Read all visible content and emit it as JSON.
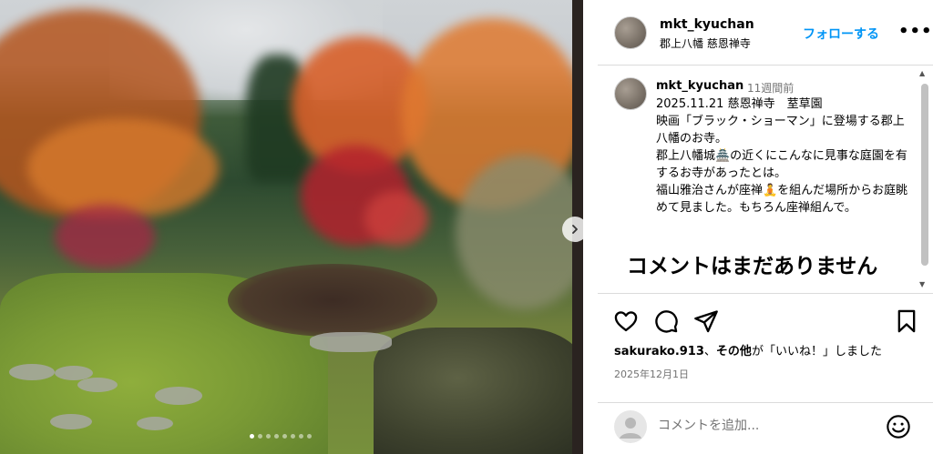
{
  "post": {
    "image_alt": "Autumn garden at Jionzenji temple",
    "carousel": {
      "total": 8,
      "active_index": 0
    }
  },
  "header": {
    "username": "mkt_kyuchan",
    "location": "郡上八幡 慈恩禅寺",
    "follow_label": "フォローする",
    "more_label": "•••"
  },
  "caption": {
    "username": "mkt_kyuchan",
    "time_ago": "11週間前",
    "text": "2025.11.21 慈恩禅寺　荎草園\n映画「ブラック・ショーマン」に登場する郡上八幡のお寺。\n郡上八幡城🏯の近くにこんなに見事な庭園を有するお寺があったとは。\n福山雅治さんが座禅🧘を組んだ場所からお庭眺めて見ました。もちろん座禅組んで。"
  },
  "comments": {
    "empty_message": "コメントはまだありません"
  },
  "actions": {
    "liked_by_user": "sakurako.913",
    "liked_by_middle": "、",
    "others_label": "その他",
    "liked_suffix": "が「いいね！」しました",
    "date": "2025年12月1日"
  },
  "comment_box": {
    "placeholder": "コメントを追加..."
  },
  "colors": {
    "accent": "#0095f6",
    "muted": "#737373",
    "divider": "#dbdbdb"
  }
}
